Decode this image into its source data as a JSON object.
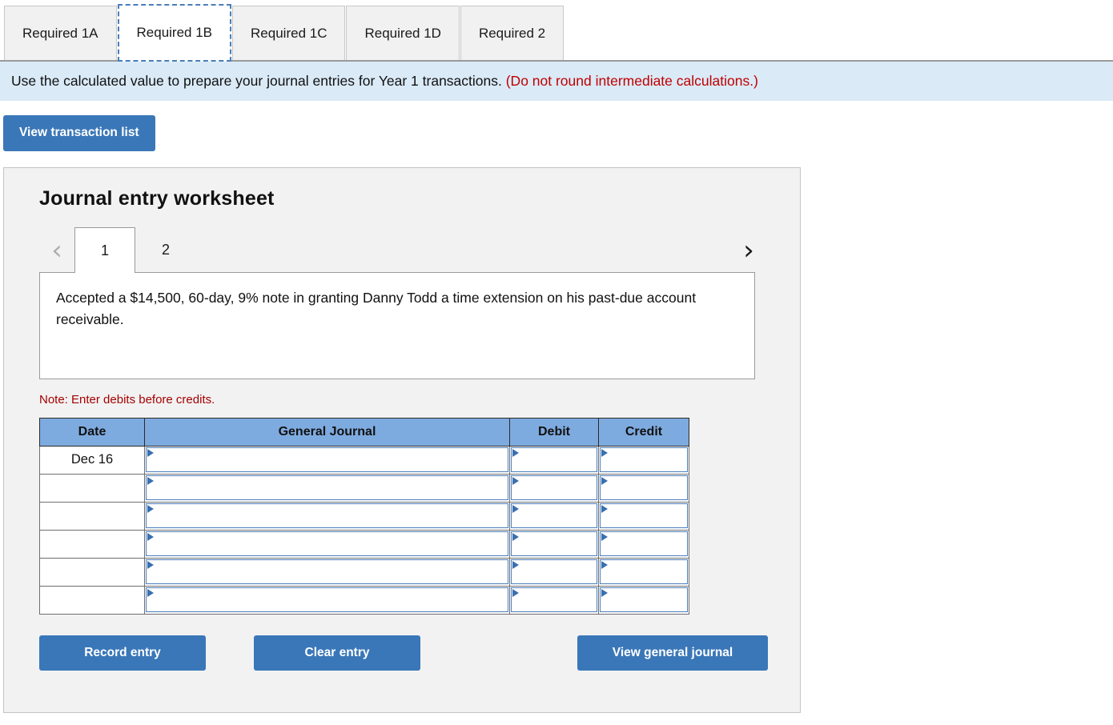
{
  "tabs": [
    {
      "label": "Required 1A",
      "active": false
    },
    {
      "label": "Required 1B",
      "active": true
    },
    {
      "label": "Required 1C",
      "active": false
    },
    {
      "label": "Required 1D",
      "active": false
    },
    {
      "label": "Required 2",
      "active": false
    }
  ],
  "instruction": {
    "text": "Use the calculated value to prepare your journal entries for Year 1 transactions.",
    "note": "(Do not round intermediate calculations.)"
  },
  "top_actions": {
    "view_transaction_list": "View transaction list"
  },
  "worksheet": {
    "title": "Journal entry worksheet",
    "pager": {
      "prev_icon": "chevron-left-icon",
      "next_icon": "chevron-right-icon",
      "pages": [
        {
          "label": "1",
          "active": true
        },
        {
          "label": "2",
          "active": false
        }
      ]
    },
    "transaction_text": "Accepted a $14,500, 60-day, 9% note in granting Danny Todd a time extension on his past-due account receivable.",
    "note": "Note: Enter debits before credits.",
    "table": {
      "headers": [
        "Date",
        "General Journal",
        "Debit",
        "Credit"
      ],
      "rows": [
        {
          "date": "Dec 16",
          "general_journal": "",
          "debit": "",
          "credit": ""
        },
        {
          "date": "",
          "general_journal": "",
          "debit": "",
          "credit": ""
        },
        {
          "date": "",
          "general_journal": "",
          "debit": "",
          "credit": ""
        },
        {
          "date": "",
          "general_journal": "",
          "debit": "",
          "credit": ""
        },
        {
          "date": "",
          "general_journal": "",
          "debit": "",
          "credit": ""
        },
        {
          "date": "",
          "general_journal": "",
          "debit": "",
          "credit": ""
        }
      ]
    },
    "buttons": {
      "record_entry": "Record entry",
      "clear_entry": "Clear entry",
      "view_general_journal": "View general journal"
    }
  },
  "colors": {
    "button_blue": "#3a77b8",
    "header_blue": "#7eabdf",
    "banner_blue": "#daeaf7",
    "note_red": "#a50000",
    "instruction_red": "#c00000",
    "panel_gray": "#f2f2f2"
  }
}
